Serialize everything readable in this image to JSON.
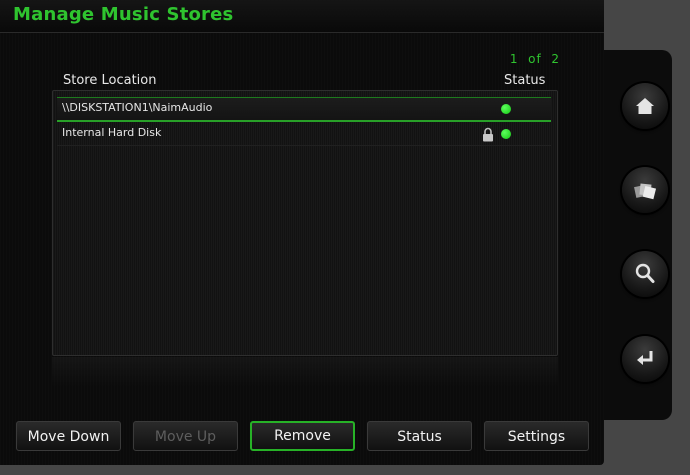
{
  "header": {
    "title": "Manage Music Stores"
  },
  "pagination": {
    "label": "1  of  2"
  },
  "table": {
    "columns": {
      "location": "Store Location",
      "status": "Status"
    },
    "rows": [
      {
        "location": "\\\\DISKSTATION1\\NaimAudio",
        "status": "online",
        "locked": false,
        "selected": true
      },
      {
        "location": "Internal Hard Disk",
        "status": "online",
        "locked": true,
        "selected": false
      }
    ]
  },
  "toolbar": {
    "move_down": "Move Down",
    "move_up": "Move Up",
    "remove": "Remove",
    "status": "Status",
    "settings": "Settings"
  },
  "sidebar": {
    "buttons": [
      {
        "icon": "home-icon"
      },
      {
        "icon": "albums-icon"
      },
      {
        "icon": "search-icon"
      },
      {
        "icon": "return-icon"
      }
    ]
  },
  "colors": {
    "accent": "#2fc42f",
    "status_online": "#22e022",
    "background": "#0b0b0b"
  }
}
